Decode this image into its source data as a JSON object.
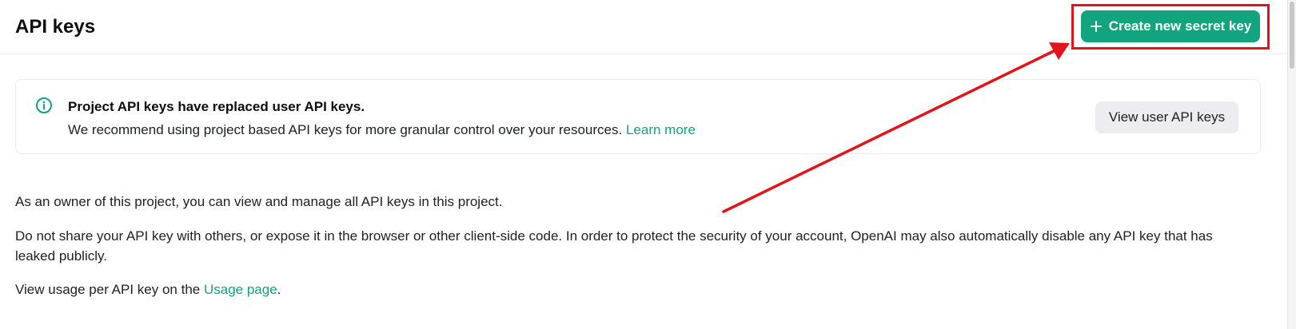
{
  "header": {
    "title": "API keys",
    "create_button_label": "Create new secret key"
  },
  "notice": {
    "title": "Project API keys have replaced user API keys.",
    "body": "We recommend using project based API keys for more granular control over your resources.",
    "learn_more_label": "Learn more",
    "view_user_keys_label": "View user API keys"
  },
  "content": {
    "owner_text": "As an owner of this project, you can view and manage all API keys in this project.",
    "warning_text": "Do not share your API key with others, or expose it in the browser or other client-side code. In order to protect the security of your account, OpenAI may also automatically disable any API key that has leaked publicly.",
    "usage_prefix": "View usage per API key on the",
    "usage_link_label": "Usage page",
    "usage_suffix": "."
  },
  "icons": {
    "create_button": "plus-icon",
    "notice": "info-icon"
  },
  "colors": {
    "accent_green": "#10a37f",
    "button_green": "#12a37f",
    "annotation_red": "#e3131b",
    "secondary_button_bg": "#ececf1"
  }
}
